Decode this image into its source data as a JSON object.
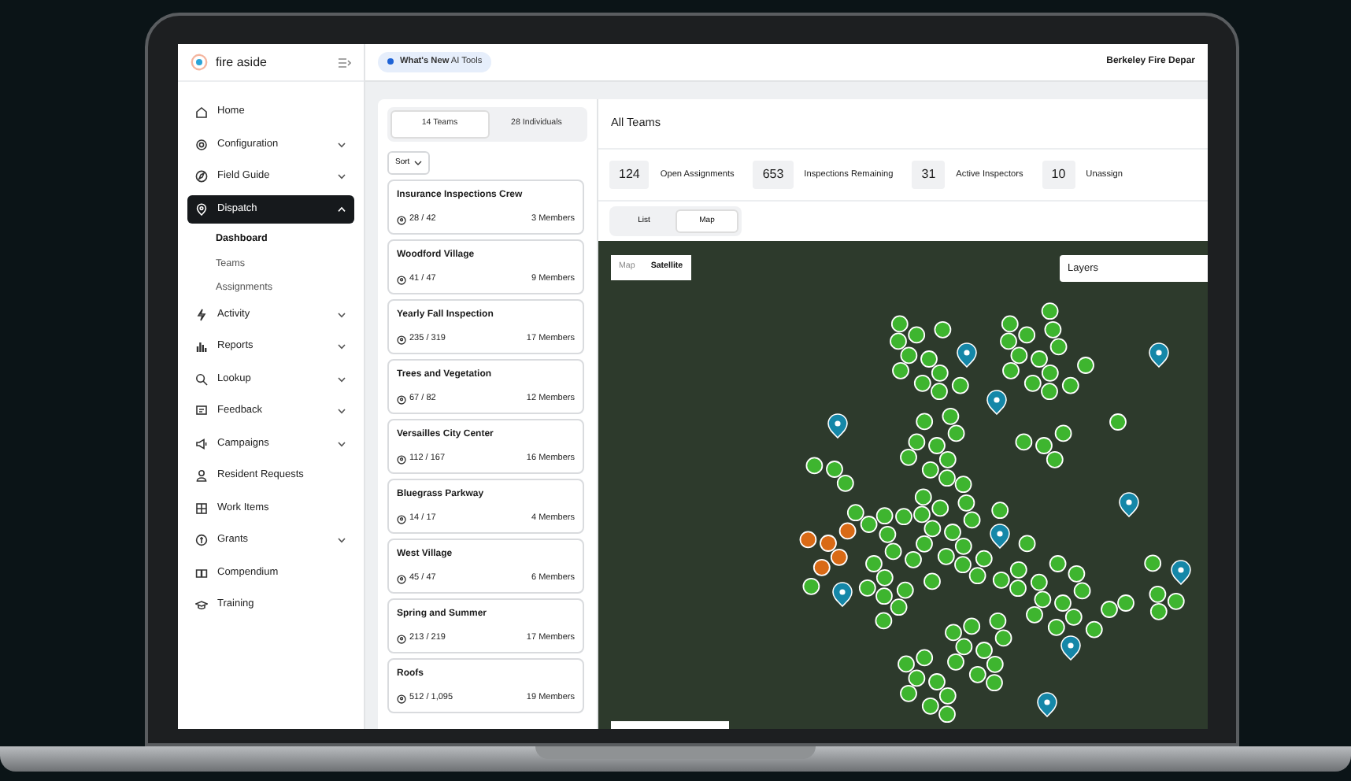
{
  "sidebar": {
    "logo": "fire aside",
    "items": [
      {
        "label": "Home",
        "kind": "link",
        "selected": false
      },
      {
        "label": "Configuration",
        "kind": "group",
        "expanded": false,
        "selected": false
      },
      {
        "label": "Field Guide",
        "kind": "group",
        "expanded": false,
        "selected": false
      },
      {
        "label": "Dispatch",
        "kind": "group",
        "expanded": true,
        "selected": true,
        "children": [
          {
            "label": "Dashboard",
            "selected": true
          },
          {
            "label": "Teams",
            "selected": false
          },
          {
            "label": "Assignments",
            "selected": false
          }
        ]
      },
      {
        "label": "Activity",
        "kind": "group",
        "expanded": false,
        "selected": false
      },
      {
        "label": "Reports",
        "kind": "group",
        "expanded": false,
        "selected": false
      },
      {
        "label": "Lookup",
        "kind": "group",
        "expanded": false,
        "selected": false
      },
      {
        "label": "Feedback",
        "kind": "group",
        "expanded": false,
        "selected": false
      },
      {
        "label": "Campaigns",
        "kind": "group",
        "expanded": false,
        "selected": false
      },
      {
        "label": "Resident Requests",
        "kind": "link",
        "selected": false
      },
      {
        "label": "Work Items",
        "kind": "link",
        "selected": false
      },
      {
        "label": "Grants",
        "kind": "group",
        "expanded": false,
        "selected": false
      },
      {
        "label": "Compendium",
        "kind": "link",
        "selected": false
      },
      {
        "label": "Training",
        "kind": "link",
        "selected": false
      }
    ]
  },
  "top_bar": {
    "announcement": "**What's New** AI Tools",
    "organization": "Berkeley Fire Depar"
  },
  "team_panel": {
    "tabs": [
      {
        "label": "14 Teams",
        "selected": true
      },
      {
        "label": "28 Individuals",
        "selected": false
      }
    ],
    "sort": "Sort",
    "teams": [
      {
        "name": "Insurance Inspections Crew",
        "progress": "28 / 42",
        "members": "3 Members"
      },
      {
        "name": "Woodford Village",
        "progress": "41 / 47",
        "members": "9 Members"
      },
      {
        "name": "Yearly Fall Inspection",
        "progress": "235 / 319",
        "members": "17 Members"
      },
      {
        "name": "Trees and Vegetation",
        "progress": "67 / 82",
        "members": "12 Members"
      },
      {
        "name": "Versailles City Center",
        "progress": "112 / 167",
        "members": "16 Members"
      },
      {
        "name": "Bluegrass Parkway",
        "progress": "14 / 17",
        "members": "4 Members"
      },
      {
        "name": "West Village",
        "progress": "45 / 47",
        "members": "6 Members"
      },
      {
        "name": "Spring and Summer",
        "progress": "213 / 219",
        "members": "17 Members"
      },
      {
        "name": "Roofs",
        "progress": "512 / 1,095",
        "members": "19 Members"
      }
    ]
  },
  "main": {
    "title": "All Teams",
    "stats": [
      {
        "value": "124",
        "label": "Open Assignments"
      },
      {
        "value": "653",
        "label": "Inspections Remaining"
      },
      {
        "value": "31",
        "label": "Active Inspectors"
      },
      {
        "value": "10",
        "label": "Unassign"
      }
    ],
    "view_tabs": [
      {
        "label": "List",
        "selected": false
      },
      {
        "label": "Map",
        "selected": true
      }
    ],
    "map": {
      "type_tabs": [
        {
          "label": "Map",
          "selected": false
        },
        {
          "label": "Satellite",
          "selected": true
        }
      ],
      "layers": "Layers"
    }
  }
}
